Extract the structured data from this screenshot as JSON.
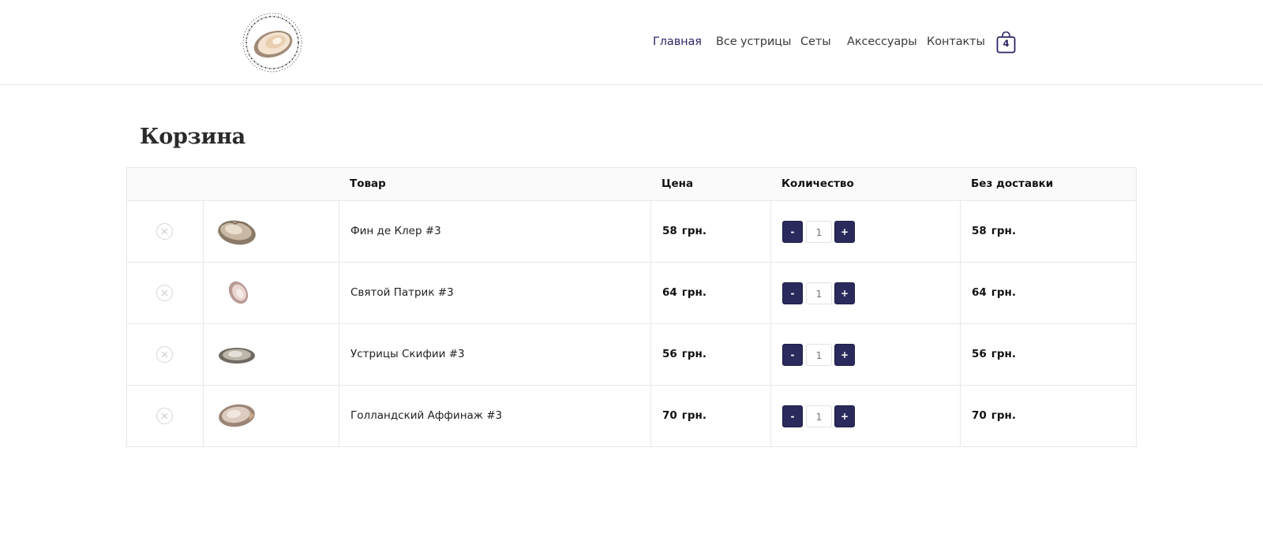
{
  "nav": {
    "items": [
      {
        "label": "Главная",
        "active": true
      },
      {
        "label": "Все устрицы",
        "active": false
      },
      {
        "label": "Сеты",
        "active": false
      },
      {
        "label": "Аксессуары",
        "active": false
      },
      {
        "label": "Контакты",
        "active": false
      }
    ],
    "cart_count": "4"
  },
  "page": {
    "title": "Корзина"
  },
  "table": {
    "headers": {
      "product": "Товар",
      "price": "Цена",
      "quantity": "Количество",
      "subtotal": "Без доставки"
    },
    "minus_label": "-",
    "plus_label": "+",
    "rows": [
      {
        "name": "Фин де Клер #3",
        "price": "58",
        "currency": "грн.",
        "qty": "1",
        "subtotal": "58"
      },
      {
        "name": "Святой Патрик #3",
        "price": "64",
        "currency": "грн.",
        "qty": "1",
        "subtotal": "64"
      },
      {
        "name": "Устрицы Скифии #3",
        "price": "56",
        "currency": "грн.",
        "qty": "1",
        "subtotal": "56"
      },
      {
        "name": "Голландский Аффинаж #3",
        "price": "70",
        "currency": "грн.",
        "qty": "1",
        "subtotal": "70"
      }
    ]
  },
  "colors": {
    "accent": "#2b2a5c",
    "nav_active": "#2b2563",
    "border": "#e8e8e8"
  }
}
